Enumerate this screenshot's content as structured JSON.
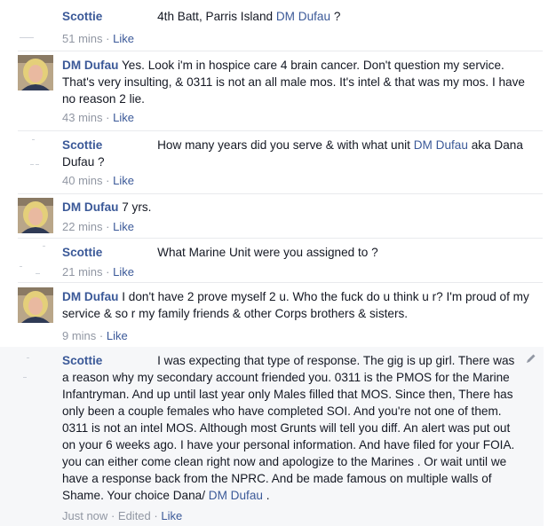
{
  "comments": [
    {
      "author": "Scottie",
      "text": "4th Batt, Parris Island",
      "mention": "DM Dufau",
      "suffix": " ?",
      "time": "51 mins",
      "like": "Like"
    },
    {
      "author": "DM Dufau",
      "text": "Yes. Look i'm in hospice care 4 brain cancer. Don't question my service. That's very insulting, & 0311 is not an all male mos. It's intel & that was my mos. I have no reason 2 lie.",
      "time": "43 mins",
      "like": "Like"
    },
    {
      "author": "Scottie",
      "text": "How many years did you serve & with what unit",
      "mention": "DM Dufau",
      "suffix": " aka Dana Dufau ?",
      "time": "40 mins",
      "like": "Like"
    },
    {
      "author": "DM Dufau",
      "text": "7 yrs.",
      "time": "22 mins",
      "like": "Like"
    },
    {
      "author": "Scottie",
      "text": "What Marine Unit were you assigned to ?",
      "time": "21 mins",
      "like": "Like"
    },
    {
      "author": "DM Dufau",
      "text": "I don't have 2 prove myself 2 u. Who the fuck do u think u r? I'm proud of my service & so r my family friends & other Corps brothers & sisters.",
      "time": "9 mins",
      "like": "Like"
    },
    {
      "author": "Scottie",
      "text": "I was expecting that type of response. The gig is up girl. There was a reason why my secondary account friended you. 0311 is the PMOS for the Marine Infantryman. And up until last year only Males filled that MOS. Since then, There has only been a couple females who have completed SOI. And you're not one of them. 0311 is not an intel MOS. Although most Grunts will tell you diff. An alert was put out on your 6 weeks ago. I have your personal information. And have filed for your FOIA. you can either come clean right now and apologize to the Marines . Or wait until we have a response back from the NPRC. And be made famous on multiple walls of Shame. Your choice Dana/",
      "mention": "DM Dufau",
      "suffix": " .",
      "time": "Just now",
      "edited": "Edited",
      "like": "Like"
    }
  ],
  "separator": "·",
  "colors": {
    "link": "#3b5998",
    "meta": "#9197a3",
    "text": "#141823"
  }
}
